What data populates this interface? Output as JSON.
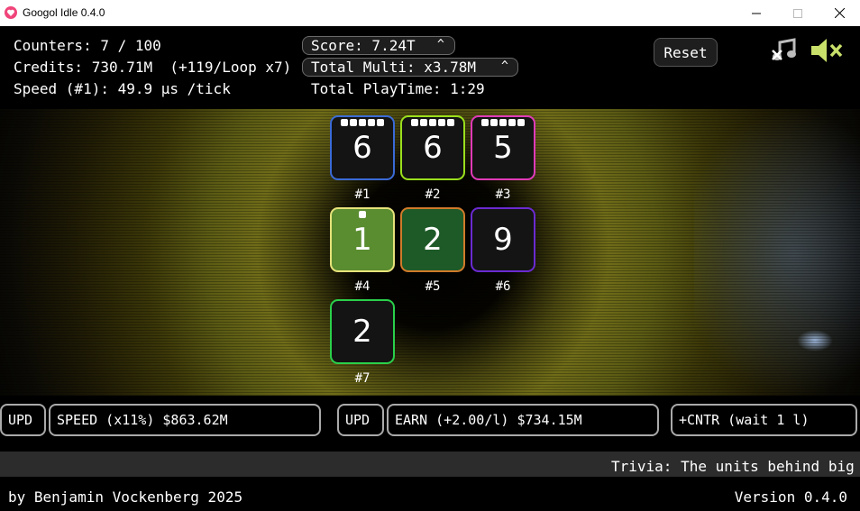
{
  "window": {
    "title": "Googol Idle 0.4.0",
    "icon": "heart-app-icon"
  },
  "stats": {
    "counters": "Counters: 7 / 100",
    "credits": "Credits: 730.71M  (+119/Loop x7)",
    "speed": "Speed (#1): 49.9 µs /tick",
    "score": "Score: 7.24T",
    "total_multi": "Total Multi: x3.78M",
    "playtime": "Total PlayTime: 1:29",
    "expand_caret": "^"
  },
  "controls": {
    "reset_label": "Reset",
    "music_icon": "music-off-icon",
    "sound_icon": "speaker-muted-icon"
  },
  "tiles": [
    {
      "value": "6",
      "label": "#1",
      "border": "#3a6ad6",
      "fill": "#141414",
      "dots": 5
    },
    {
      "value": "6",
      "label": "#2",
      "border": "#9adf1c",
      "fill": "#141414",
      "dots": 5
    },
    {
      "value": "5",
      "label": "#3",
      "border": "#e03ab8",
      "fill": "#141414",
      "dots": 5
    },
    {
      "value": "1",
      "label": "#4",
      "border": "#e6e27a",
      "fill": "#5a8c30",
      "dots": 1
    },
    {
      "value": "2",
      "label": "#5",
      "border": "#d07a2a",
      "fill": "#1e5a28",
      "dots": 0
    },
    {
      "value": "9",
      "label": "#6",
      "border": "#6a2ad0",
      "fill": "#141414",
      "dots": 0
    },
    {
      "value": "2",
      "label": "#7",
      "border": "#2ad04a",
      "fill": "#141414",
      "dots": 0
    }
  ],
  "actions": {
    "upd1": "UPD",
    "speed": "SPEED (x11%) $863.62M",
    "upd2": "UPD",
    "earn": "EARN (+2.00/l) $734.15M",
    "add_counter": "+CNTR (wait 1 l)"
  },
  "trivia": "Trivia: The units behind big",
  "footer": {
    "author": "by Benjamin Vockenberg 2025",
    "version": "Version 0.4.0"
  }
}
